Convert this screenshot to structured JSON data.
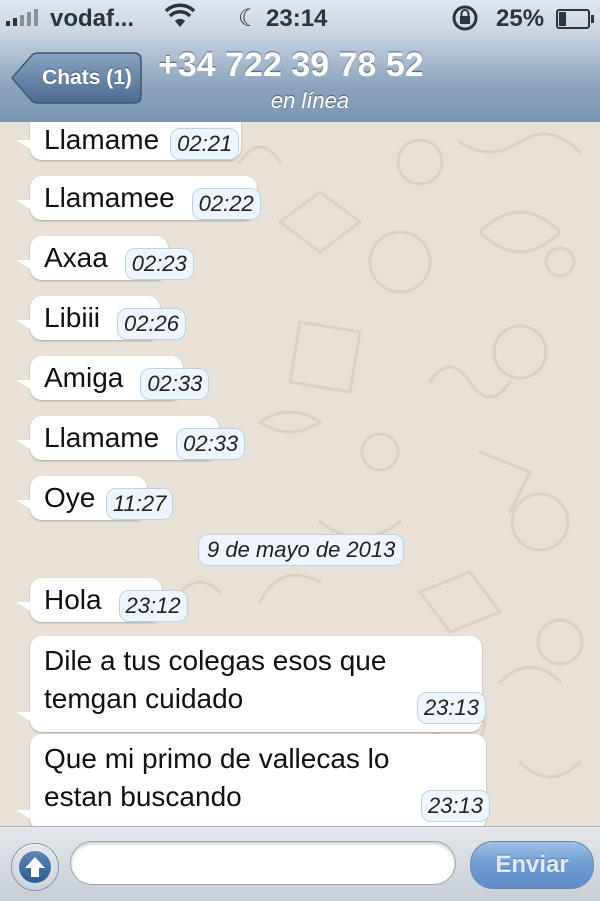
{
  "status_bar": {
    "carrier": "vodaf...",
    "time": "23:14",
    "battery": "25%",
    "battery_level": 0.25
  },
  "nav": {
    "back_label": "Chats (1)",
    "title": "+34 722 39 78 52",
    "subtitle": "en línea"
  },
  "messages": [
    {
      "text": "Llamame",
      "time": "02:21"
    },
    {
      "text": "Llamamee",
      "time": "02:22"
    },
    {
      "text": "Axaa",
      "time": "02:23"
    },
    {
      "text": "Libiii",
      "time": "02:26"
    },
    {
      "text": "Amiga",
      "time": "02:33"
    },
    {
      "text": "Llamame",
      "time": "02:33"
    },
    {
      "text": "Oye",
      "time": "11:27"
    },
    {
      "text": "Hola",
      "time": "23:12"
    },
    {
      "text": "Dile a tus colegas esos que temgan cuidado",
      "time": "23:13"
    },
    {
      "text": "Que mi primo de vallecas lo estan buscando",
      "time": "23:13"
    }
  ],
  "date_divider": "9 de mayo de 2013",
  "composer": {
    "placeholder": "",
    "send_label": "Enviar"
  },
  "colors": {
    "nav_gradient": "#8ea5bd",
    "bubble": "#ffffff",
    "time_badge": "#eef5fc",
    "background": "#e6e0d6"
  }
}
